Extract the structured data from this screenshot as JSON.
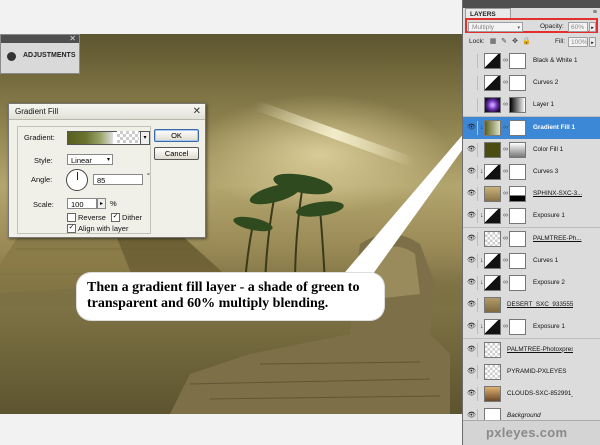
{
  "adjustments_panel": {
    "title": "ADJUSTMENTS"
  },
  "gradient_fill_dialog": {
    "title": "Gradient Fill",
    "gradient_label": "Gradient:",
    "style_label": "Style:",
    "style_value": "Linear",
    "angle_label": "Angle:",
    "angle_value": "85",
    "angle_unit": "°",
    "scale_label": "Scale:",
    "scale_value": "100",
    "scale_unit": "%",
    "reverse_label": "Reverse",
    "reverse_checked": false,
    "dither_label": "Dither",
    "dither_checked": true,
    "align_label": "Align with layer",
    "align_checked": true,
    "ok_label": "OK",
    "cancel_label": "Cancel"
  },
  "callout": {
    "text": "Then a gradient fill layer - a shade of green to transparent and 60% multiply blending."
  },
  "layers_panel": {
    "tab_label": "LAYERS",
    "blend_mode": "Multiply",
    "opacity_label": "Opacity:",
    "opacity_value": "60%",
    "lock_label": "Lock:",
    "fill_label": "Fill:",
    "fill_value": "100%",
    "layers": [
      {
        "name": "Black & White 1",
        "visible": false,
        "selected": false,
        "clipped": false,
        "style": "plain"
      },
      {
        "name": "Curves 2",
        "visible": false,
        "selected": false,
        "clipped": false,
        "style": "plain"
      },
      {
        "name": "Layer 1",
        "visible": false,
        "selected": false,
        "clipped": false,
        "style": "plain"
      },
      {
        "name": "Gradient Fill 1",
        "visible": true,
        "selected": true,
        "clipped": true,
        "style": "plain"
      },
      {
        "name": "Color Fill 1",
        "visible": true,
        "selected": false,
        "clipped": false,
        "style": "plain"
      },
      {
        "name": "Curves 3",
        "visible": true,
        "selected": false,
        "clipped": true,
        "style": "plain"
      },
      {
        "name": "SPHINX-SXC-3...",
        "visible": true,
        "selected": false,
        "clipped": false,
        "style": "underline"
      },
      {
        "name": "Exposure 1",
        "visible": true,
        "selected": false,
        "clipped": true,
        "style": "plain"
      },
      {
        "name": "PALMTREE-Ph...",
        "visible": true,
        "selected": false,
        "clipped": false,
        "style": "underline"
      },
      {
        "name": "Curves 1",
        "visible": true,
        "selected": false,
        "clipped": true,
        "style": "plain"
      },
      {
        "name": "Exposure 2",
        "visible": true,
        "selected": false,
        "clipped": true,
        "style": "plain"
      },
      {
        "name": "DESERT_SXC_933555_166...",
        "visible": true,
        "selected": false,
        "clipped": false,
        "style": "underline"
      },
      {
        "name": "Exposure 1",
        "visible": true,
        "selected": false,
        "clipped": true,
        "style": "plain"
      },
      {
        "name": "PALMTREE-Photoxpress_...",
        "visible": true,
        "selected": false,
        "clipped": false,
        "style": "underline"
      },
      {
        "name": "PYRAMID-PXLEYES",
        "visible": true,
        "selected": false,
        "clipped": false,
        "style": "plain"
      },
      {
        "name": "CLOUDS-SXC-852991_794...",
        "visible": true,
        "selected": false,
        "clipped": false,
        "style": "plain"
      },
      {
        "name": "Background",
        "visible": true,
        "selected": false,
        "clipped": false,
        "style": "italic"
      }
    ]
  },
  "watermark": {
    "text": "pxleyes.com"
  }
}
